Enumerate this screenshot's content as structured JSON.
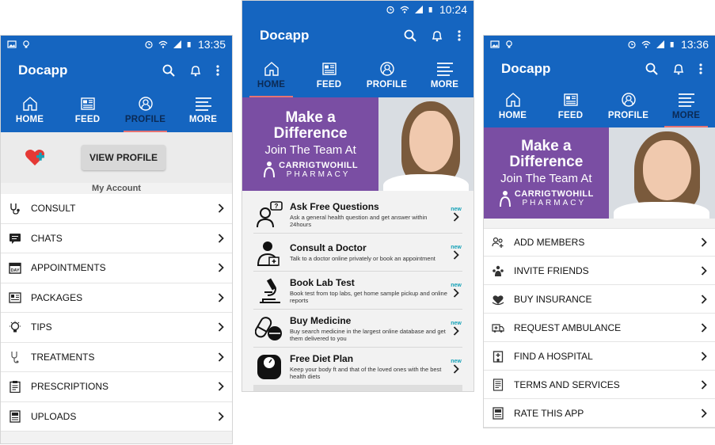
{
  "phones": [
    {
      "status": {
        "time": "13:35"
      },
      "app_title": "Docapp",
      "tabs": [
        {
          "icon": "home-icon",
          "label": "HOME"
        },
        {
          "icon": "feed-icon",
          "label": "FEED"
        },
        {
          "icon": "profile-icon",
          "label": "PROFILE"
        },
        {
          "icon": "menu-icon",
          "label": "MORE"
        }
      ],
      "active_tab": 2,
      "profile_button": "VIEW PROFILE",
      "section_title": "My Account",
      "menu": [
        {
          "icon": "stethoscope-icon",
          "label": "CONSULT"
        },
        {
          "icon": "chat-icon",
          "label": "CHATS"
        },
        {
          "icon": "calendar-day-icon",
          "label": "APPOINTMENTS"
        },
        {
          "icon": "package-icon",
          "label": "PACKAGES"
        },
        {
          "icon": "lightbulb-icon",
          "label": "TIPS"
        },
        {
          "icon": "stethoscope-icon",
          "label": "TREATMENTS"
        },
        {
          "icon": "clipboard-icon",
          "label": "PRESCRIPTIONS"
        },
        {
          "icon": "upload-icon",
          "label": "UPLOADS"
        }
      ]
    },
    {
      "status": {
        "time": "10:24"
      },
      "app_title": "Docapp",
      "tabs": [
        {
          "icon": "home-icon",
          "label": "HOME"
        },
        {
          "icon": "feed-icon",
          "label": "FEED"
        },
        {
          "icon": "profile-icon",
          "label": "PROFILE"
        },
        {
          "icon": "menu-icon",
          "label": "MORE"
        }
      ],
      "active_tab": 0,
      "banner": {
        "line1": "Make a",
        "line2": "Difference",
        "line3": "Join The Team At",
        "brand1": "CARRIGTWOHILL",
        "brand2": "PHARMACY"
      },
      "services": [
        {
          "icon": "question-person-icon",
          "title": "Ask Free Questions",
          "desc": "Ask a general health question and get answer within 24hours",
          "badge": "new"
        },
        {
          "icon": "doctor-icon",
          "title": "Consult a Doctor",
          "desc": "Talk to a doctor online privately or book an appointment",
          "badge": "new"
        },
        {
          "icon": "microscope-icon",
          "title": "Book Lab Test",
          "desc": "Book test from top labs, get home sample pickup and online reports",
          "badge": "new"
        },
        {
          "icon": "pills-icon",
          "title": "Buy Medicine",
          "desc": "Buy search medicine in the largest online database and get them delivered to you",
          "badge": "new"
        },
        {
          "icon": "scale-icon",
          "title": "Free Diet Plan",
          "desc": "Keep your body ft and that of the loved ones with the best health diets",
          "badge": "new"
        }
      ]
    },
    {
      "status": {
        "time": "13:36"
      },
      "app_title": "Docapp",
      "tabs": [
        {
          "icon": "home-icon",
          "label": "HOME"
        },
        {
          "icon": "feed-icon",
          "label": "FEED"
        },
        {
          "icon": "profile-icon",
          "label": "PROFILE"
        },
        {
          "icon": "menu-icon",
          "label": "MORE"
        }
      ],
      "active_tab": 3,
      "banner": {
        "line1": "Make a",
        "line2": "Difference",
        "line3": "Join The Team At",
        "brand1": "CARRIGTWOHILL",
        "brand2": "PHARMACY"
      },
      "menu": [
        {
          "icon": "add-members-icon",
          "label": "ADD MEMBERS"
        },
        {
          "icon": "invite-icon",
          "label": "INVITE FRIENDS"
        },
        {
          "icon": "insurance-icon",
          "label": "BUY INSURANCE"
        },
        {
          "icon": "ambulance-icon",
          "label": "REQUEST AMBULANCE"
        },
        {
          "icon": "hospital-icon",
          "label": "FIND A HOSPITAL"
        },
        {
          "icon": "document-icon",
          "label": "TERMS AND SERVICES"
        },
        {
          "icon": "rate-icon",
          "label": "RATE THIS APP"
        }
      ]
    }
  ],
  "colors": {
    "primary": "#1565c0",
    "banner_purple": "#7a4ea3",
    "accent_teal": "#17a2b8",
    "tab_underline": "#e57373",
    "heart": "#e53935"
  }
}
